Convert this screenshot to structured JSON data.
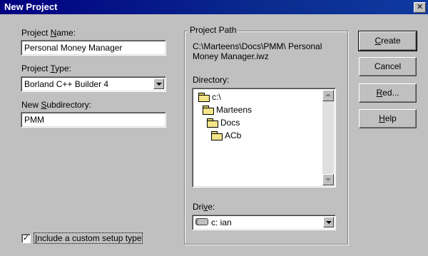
{
  "window": {
    "title": "New Project",
    "close_glyph": "✕"
  },
  "form": {
    "project_name": {
      "label_pre": "Project ",
      "label_key": "N",
      "label_post": "ame:",
      "value": "Personal Money Manager"
    },
    "project_type": {
      "label_pre": "Project ",
      "label_key": "T",
      "label_post": "ype:",
      "value": "Borland C++ Builder 4"
    },
    "new_subdirectory": {
      "label_pre": "New ",
      "label_key": "S",
      "label_post": "ubdirectory:",
      "value": "PMM"
    },
    "custom_setup": {
      "checked": true,
      "check_glyph": "✓",
      "label_key": "I",
      "label_post": "nclude a custom setup type"
    }
  },
  "project_path": {
    "group_title": "Project Path",
    "path_line1": "C:\\Marteens\\Docs\\PMM\\ Personal",
    "path_line2": "Money Manager.iwz",
    "directory_label": "Directory:",
    "tree": [
      {
        "name": "c:\\",
        "icon": "open-folder-icon"
      },
      {
        "name": "Marteens",
        "icon": "open-folder-icon"
      },
      {
        "name": "Docs",
        "icon": "open-folder-icon"
      },
      {
        "name": "ACb",
        "icon": "folder-icon"
      }
    ],
    "drive_label_pre": "Dri",
    "drive_label_key": "v",
    "drive_label_post": "e:",
    "drive_value": "c: ian",
    "drive_icon": "hard-drive-icon"
  },
  "buttons": {
    "create": {
      "key": "C",
      "rest": "reate"
    },
    "cancel": {
      "label": "Cancel"
    },
    "red": {
      "key": "R",
      "rest": "ed..."
    },
    "help": {
      "key": "H",
      "rest": "elp"
    }
  }
}
